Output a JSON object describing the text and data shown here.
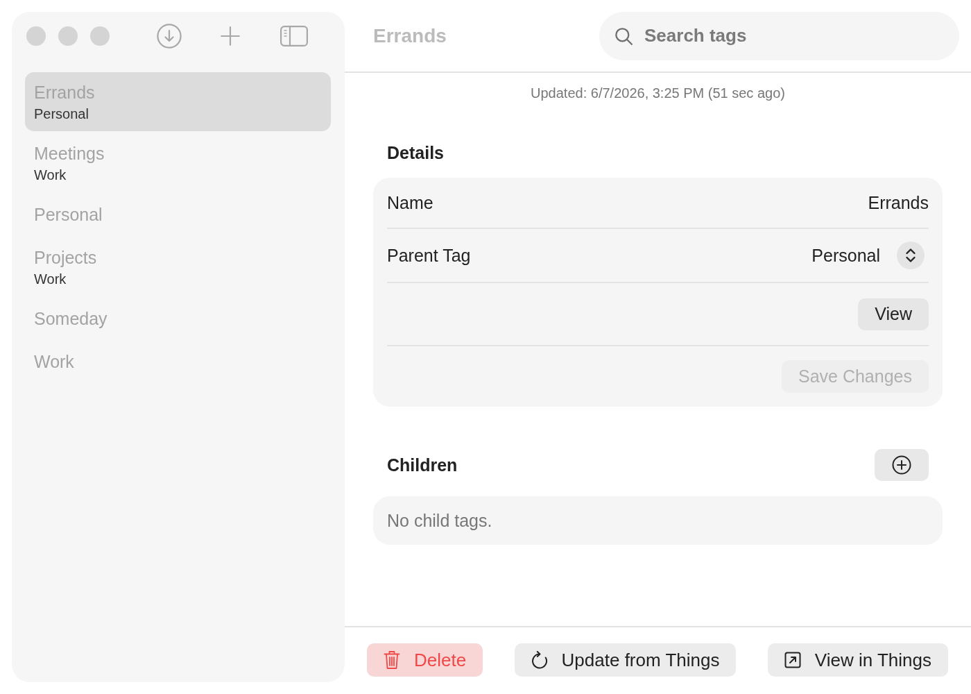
{
  "sidebar": {
    "items": [
      {
        "name": "Errands",
        "parent": "Personal",
        "selected": true
      },
      {
        "name": "Meetings",
        "parent": "Work",
        "selected": false
      },
      {
        "name": "Personal",
        "selected": false
      },
      {
        "name": "Projects",
        "parent": "Work",
        "selected": false
      },
      {
        "name": "Someday",
        "selected": false
      },
      {
        "name": "Work",
        "selected": false
      }
    ]
  },
  "header": {
    "title": "Errands",
    "search": {
      "placeholder": "Search tags"
    }
  },
  "updated": "Updated: 6/7/2026, 3:25 PM (51 sec ago)",
  "details": {
    "heading": "Details",
    "rows": [
      {
        "kind": "text",
        "label": "Name",
        "value": "Errands"
      },
      {
        "kind": "picker",
        "label": "Parent Tag",
        "value": "Personal"
      }
    ],
    "view_button": "View",
    "save_button": {
      "label": "Save Changes",
      "disabled": true
    }
  },
  "children": {
    "heading": "Children",
    "empty_text": "No child tags."
  },
  "footer": {
    "buttons": [
      {
        "kind": "destructive",
        "label": "Delete"
      },
      {
        "kind": "refresh",
        "label": "Update from Things"
      },
      {
        "kind": "external",
        "label": "View in Things"
      }
    ]
  }
}
